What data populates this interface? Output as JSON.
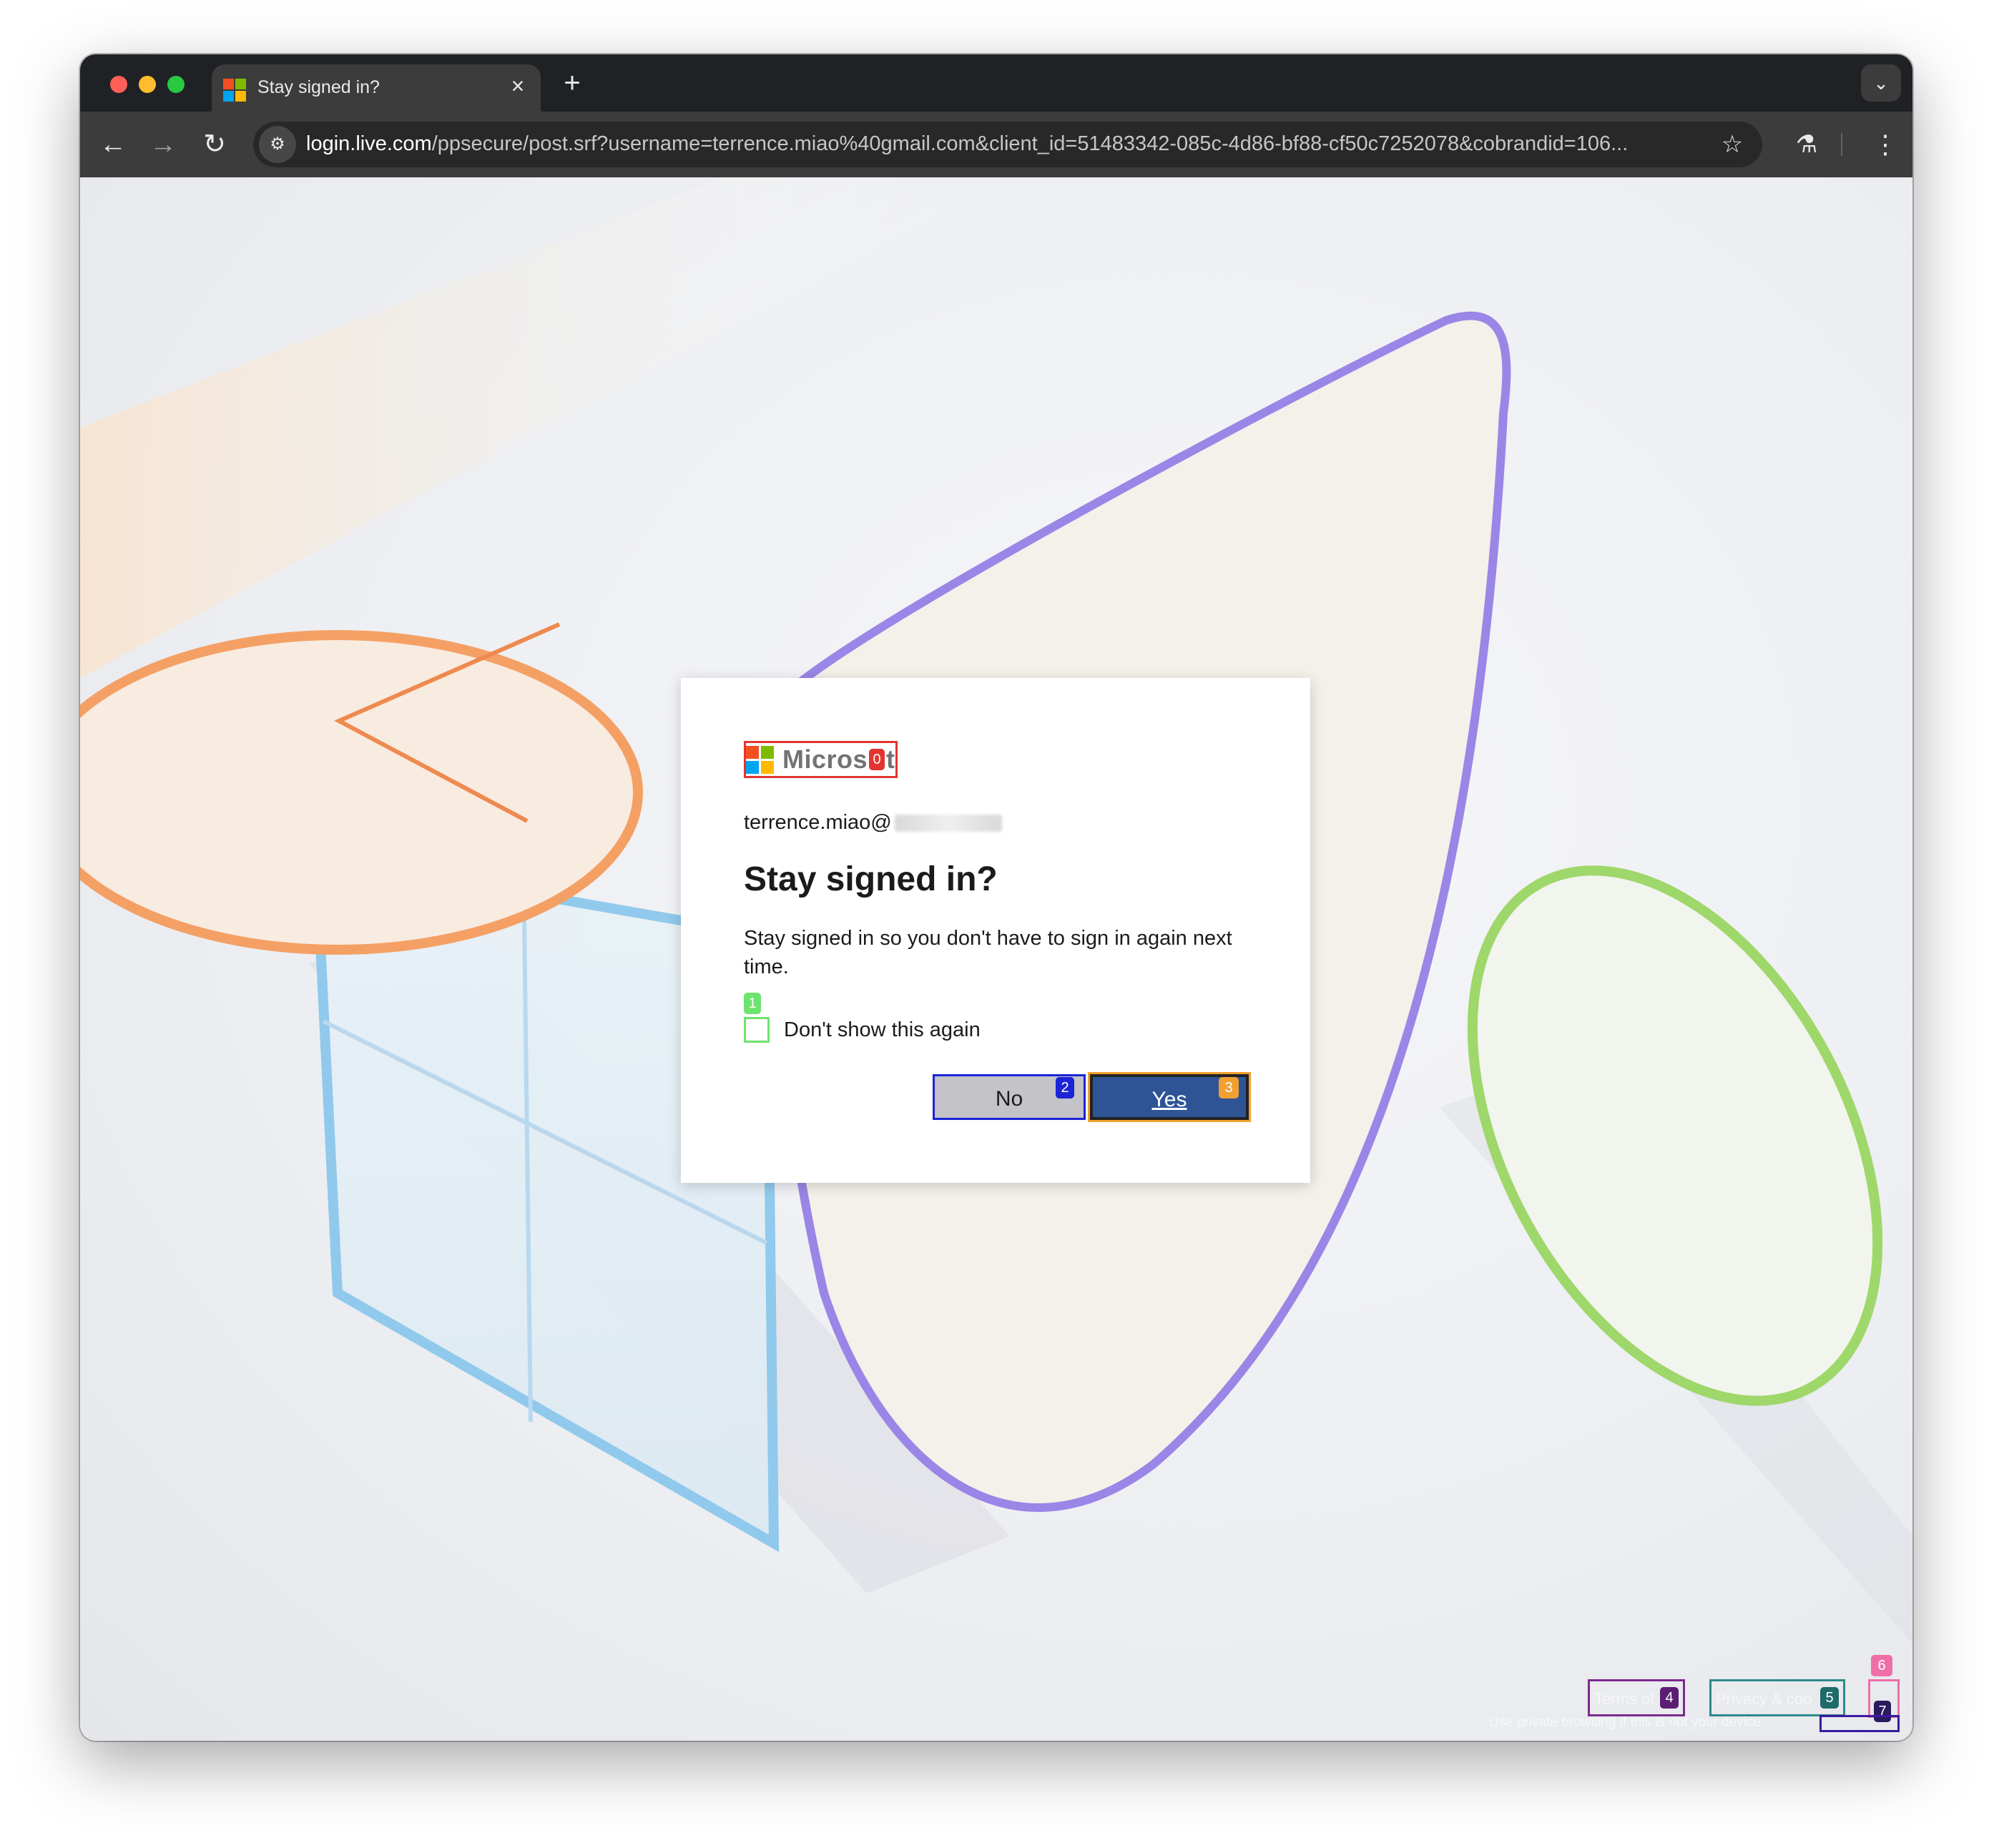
{
  "browser": {
    "tab_title": "Stay signed in?",
    "tab_close": "×",
    "new_tab": "+",
    "tab_menu": "⌄",
    "url_host": "login.live.com",
    "url_rest": "/ppsecure/post.srf?username=terrence.miao%40gmail.com&client_id=51483342-085c-4d86-bf88-cf50c7252078&cobrandid=106...",
    "back": "←",
    "forward": "→",
    "reload": "↻",
    "star": "☆",
    "lab": "⚗",
    "menu": "⋮",
    "site_info": "⚙"
  },
  "dialog": {
    "logo_text": "Micros",
    "logo_tail": "t",
    "email": "terrence.miao@",
    "title": "Stay signed in?",
    "description": "Stay signed in so you don't have to sign in again next time.",
    "checkbox_label": "Don't show this again",
    "no_label": "No",
    "yes_label": "Yes"
  },
  "footer": {
    "terms": "Terms of",
    "privacy": "Privacy & coo",
    "note": "Use private browsing if this is not your device."
  },
  "badges": [
    "0",
    "1",
    "2",
    "3",
    "4",
    "5",
    "6",
    "7"
  ],
  "colors": {
    "ms_red": "#f25022",
    "ms_green": "#7fba00",
    "ms_blue": "#00a4ef",
    "ms_yellow": "#ffb900",
    "yes_button": "#2f5496",
    "no_button": "#c3c3c8"
  }
}
